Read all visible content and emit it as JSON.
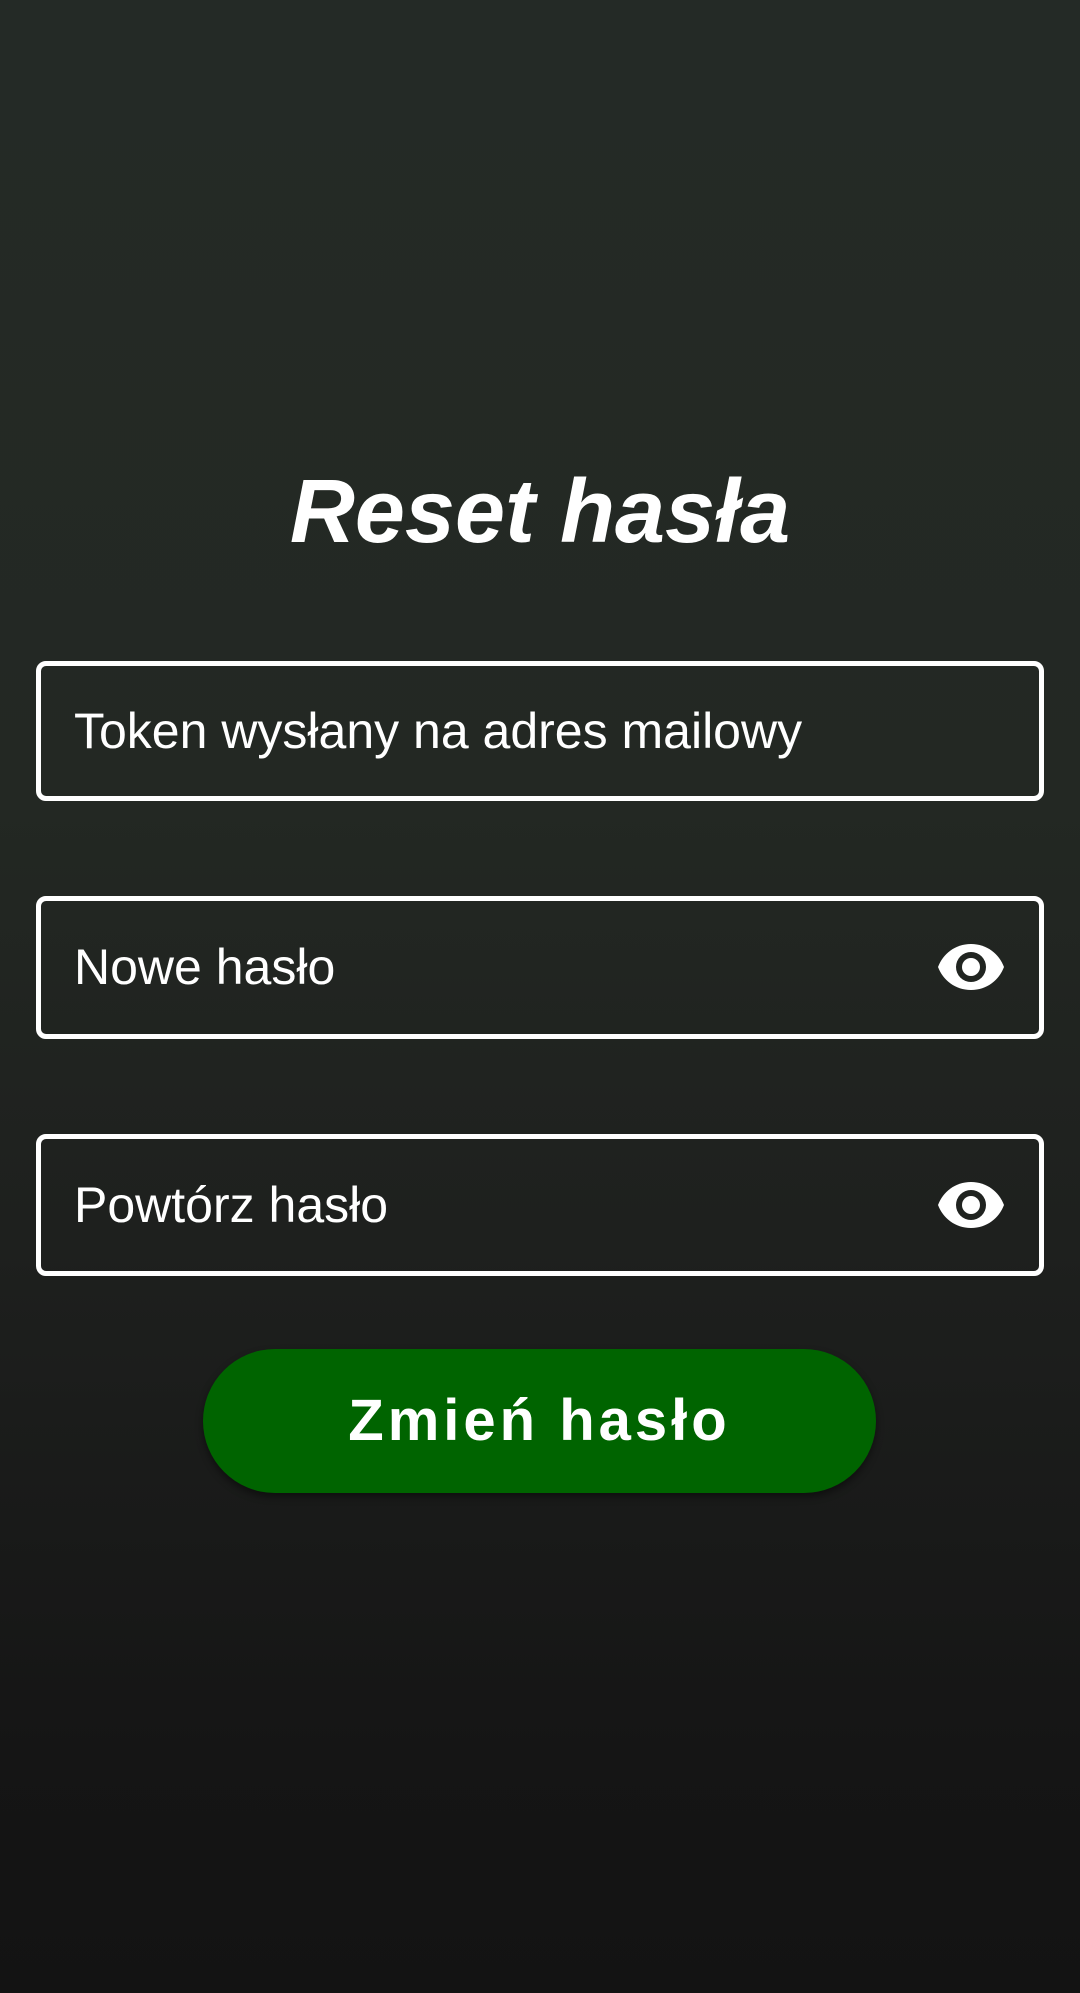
{
  "page": {
    "title": "Reset hasła"
  },
  "form": {
    "token_field": {
      "placeholder": "Token wysłany na adres mailowy"
    },
    "new_password_field": {
      "placeholder": "Nowe hasło",
      "toggle_icon": "eye-icon"
    },
    "repeat_password_field": {
      "placeholder": "Powtórz hasło",
      "toggle_icon": "eye-icon"
    },
    "submit_label": "Zmień hasło"
  },
  "colors": {
    "background_top": "#242a26",
    "background_bottom": "#131313",
    "field_border": "#ffffff",
    "button": "#006400",
    "text": "#ffffff"
  }
}
